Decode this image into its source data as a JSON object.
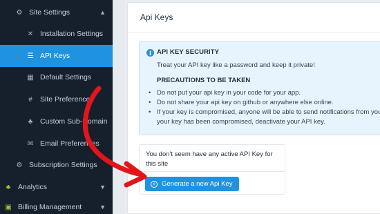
{
  "sidebar": {
    "items": [
      {
        "label": "Site Settings",
        "icon": "gear-icon",
        "level": "top"
      },
      {
        "label": "Installation Settings",
        "icon": "wrench-icon",
        "level": "sub"
      },
      {
        "label": "API Keys",
        "icon": "sliders-icon",
        "level": "sub",
        "active": true
      },
      {
        "label": "Default Settings",
        "icon": "grid-icon",
        "level": "sub"
      },
      {
        "label": "Site Preferences",
        "icon": "hash-icon",
        "level": "sub"
      },
      {
        "label": "Custom Sub-Domain",
        "icon": "sitemap-icon",
        "level": "sub"
      },
      {
        "label": "Email Preferences",
        "icon": "envelope-icon",
        "level": "sub"
      },
      {
        "label": "Subscription Settings",
        "icon": "gear-icon",
        "level": "top"
      },
      {
        "label": "Analytics",
        "icon": "leaf-icon",
        "level": "root"
      },
      {
        "label": "Billing Management",
        "icon": "money-icon",
        "level": "root"
      }
    ]
  },
  "panel": {
    "title": "Api Keys"
  },
  "alert": {
    "title": "API KEY SECURITY",
    "text": "Treat your API key like a password and keep it private!",
    "subtitle": "PRECAUTIONS TO BE TAKEN",
    "bullets": [
      "Do not put your api key in your code for your app.",
      "Do not share your api key on github or anywhere else online.",
      "If your key is compromised, anyone will be able to send notifications from your",
      "your key has been compromised, deactivate your API key."
    ]
  },
  "no_key": {
    "message": "You don't seem have any active API Key for this site",
    "button_label": "Generate a new Api Key"
  },
  "colors": {
    "sidebar_bg": "#16202c",
    "accent": "#1f93e0",
    "arrow": "#e3151b"
  }
}
